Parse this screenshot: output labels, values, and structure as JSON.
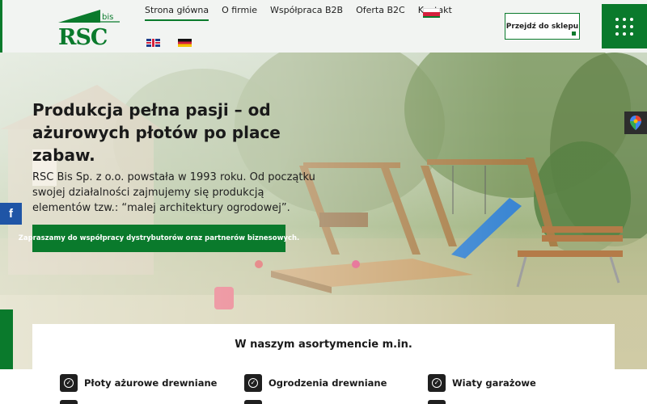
{
  "header": {
    "logo_text_top": "bis",
    "logo_text_main": "RSC",
    "nav": [
      {
        "label": "Strona główna",
        "active": true
      },
      {
        "label": "O firmie",
        "active": false
      },
      {
        "label": "Współpraca B2B",
        "active": false
      },
      {
        "label": "Oferta B2C",
        "active": false
      },
      {
        "label": "Kontakt",
        "active": false
      }
    ],
    "shop_button": "Przejdź do sklepu",
    "accent_color": "#0a7a2c"
  },
  "hero": {
    "title": "Produkcja pełna pasji – od ażurowych płotów po place zabaw.",
    "description": "RSC Bis Sp. z o.o. powstała w 1993 roku. Od początku swojej działalności zajmujemy się produkcją elementów tzw.: “malej architektury ogrodowej”.",
    "cta": "Zapraszamy do współpracy dystrybutorów oraz partnerów biznesowych."
  },
  "social": {
    "facebook": "f"
  },
  "assortment": {
    "title": "W naszym asortymencie m.in.",
    "items": [
      {
        "label": "Płoty ażurowe drewniane"
      },
      {
        "label": "Ogrodzenia drewniane"
      },
      {
        "label": "Wiaty garażowe"
      }
    ]
  }
}
